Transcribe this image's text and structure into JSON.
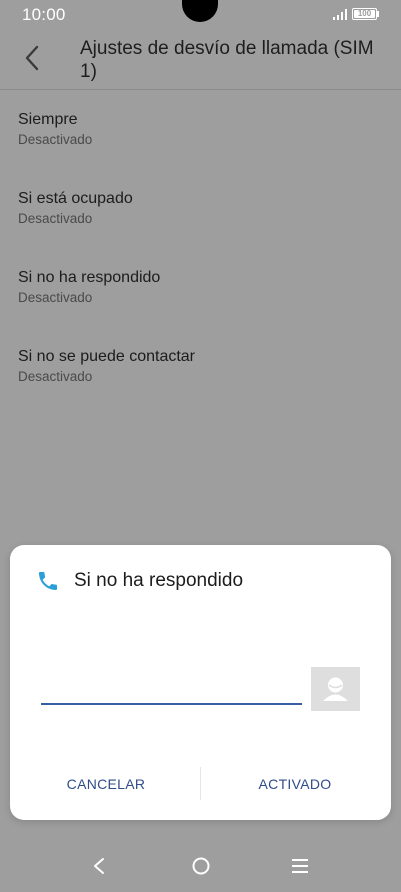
{
  "status_bar": {
    "time": "10:00",
    "battery": "100"
  },
  "header": {
    "title": "Ajustes de desvío de llamada (SIM 1)",
    "back_icon": "chevron-left-icon"
  },
  "list": {
    "items": [
      {
        "title": "Siempre",
        "subtitle": "Desactivado"
      },
      {
        "title": "Si está ocupado",
        "subtitle": "Desactivado"
      },
      {
        "title": "Si no ha respondido",
        "subtitle": "Desactivado"
      },
      {
        "title": "Si no se puede contactar",
        "subtitle": "Desactivado"
      }
    ]
  },
  "dialog": {
    "title": "Si no ha respondido",
    "phone_icon": "phone-icon",
    "input_value": "",
    "contact_icon": "contact-icon",
    "cancel_label": "CANCELAR",
    "activate_label": "ACTIVADO"
  },
  "nav": {
    "back_icon": "nav-back-icon",
    "home_icon": "nav-home-icon",
    "menu_icon": "nav-menu-icon"
  },
  "colors": {
    "accent": "#3a5ea5",
    "phone_icon": "#2a9fd8",
    "scrim_background": "#9e9e9f"
  }
}
